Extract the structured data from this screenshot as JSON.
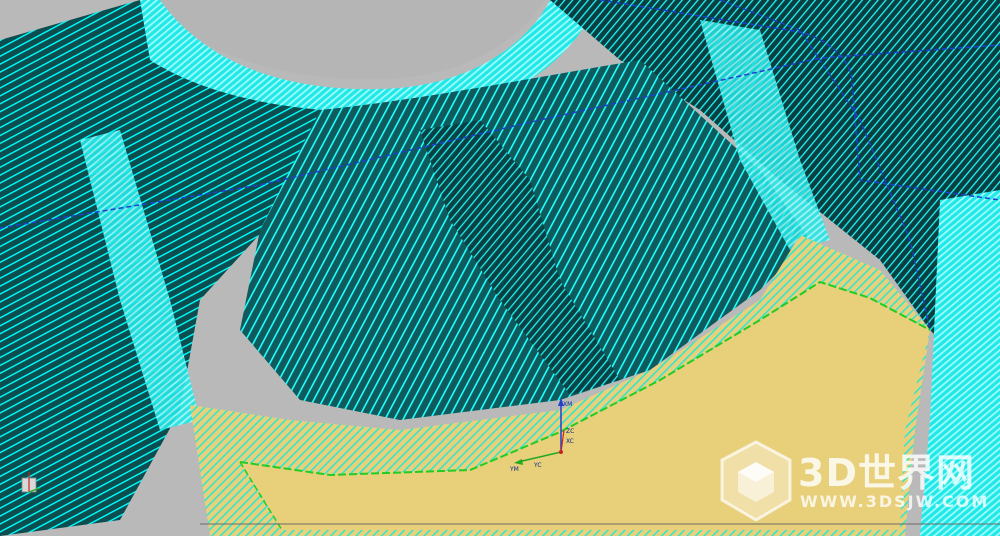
{
  "viewport": {
    "background_color": "#b9b9b9",
    "toolpath_color": "#00ffff",
    "surface_dark_color": "#0b4a4a",
    "floor_color": "#e8cf7a",
    "boundary_line_color": "#1f3fd0",
    "green_edge_color": "#22cc22"
  },
  "wcs": {
    "x_label": "XM",
    "y_label": "YM",
    "yc_label": "YC",
    "zc_label": "ZC",
    "xc_label": "XC"
  },
  "watermark": {
    "title": "3D世界网",
    "url": "WWW.3DSJW.COM",
    "logo_icon": "cube-icon"
  }
}
